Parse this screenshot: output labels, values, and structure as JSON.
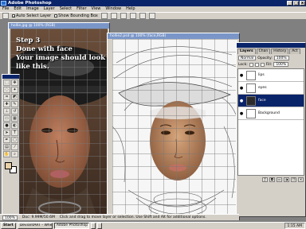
{
  "window": {
    "title": "Adobe Photoshop"
  },
  "menu": [
    "File",
    "Edit",
    "Image",
    "Layer",
    "Select",
    "Filter",
    "View",
    "Window",
    "Help"
  ],
  "options_bar": {
    "auto_select_label": "Auto Select Layer",
    "auto_select_checked": true,
    "bounding_box_label": "Show Bounding Box",
    "bounding_box_checked": false
  },
  "doc1": {
    "title": "hollie.jpg @ 100% (RGB)",
    "overlay_lines": [
      "Step 3",
      "Done with face",
      "Your image should look",
      "like this."
    ]
  },
  "doc2": {
    "title": "hollie2.psd @ 100% (face,RGB)"
  },
  "status": {
    "zoom": "100%",
    "doc_size": "Doc: 9.99M/50.6M",
    "hint": "Click and drag to move layer or selection. Use Shift and Alt for additional options."
  },
  "layers_panel": {
    "tabs": [
      "Layers",
      "Chan",
      "History",
      "Act"
    ],
    "mode": "Normal",
    "opacity_label": "Opacity:",
    "opacity": "100%",
    "lock_label": "Lock:",
    "fill_label": "Fill:",
    "fill": "100%",
    "layers": [
      {
        "name": "lips",
        "active": false
      },
      {
        "name": "eyes",
        "active": false
      },
      {
        "name": "face",
        "active": true
      },
      {
        "name": "Background",
        "active": false
      }
    ]
  },
  "taskbar": {
    "start": "Start",
    "tasks": [
      "DeviantART - Where ART",
      "Adobe Photoshop",
      "",
      ""
    ],
    "active_index": 1,
    "clock": "1:15 AM"
  }
}
